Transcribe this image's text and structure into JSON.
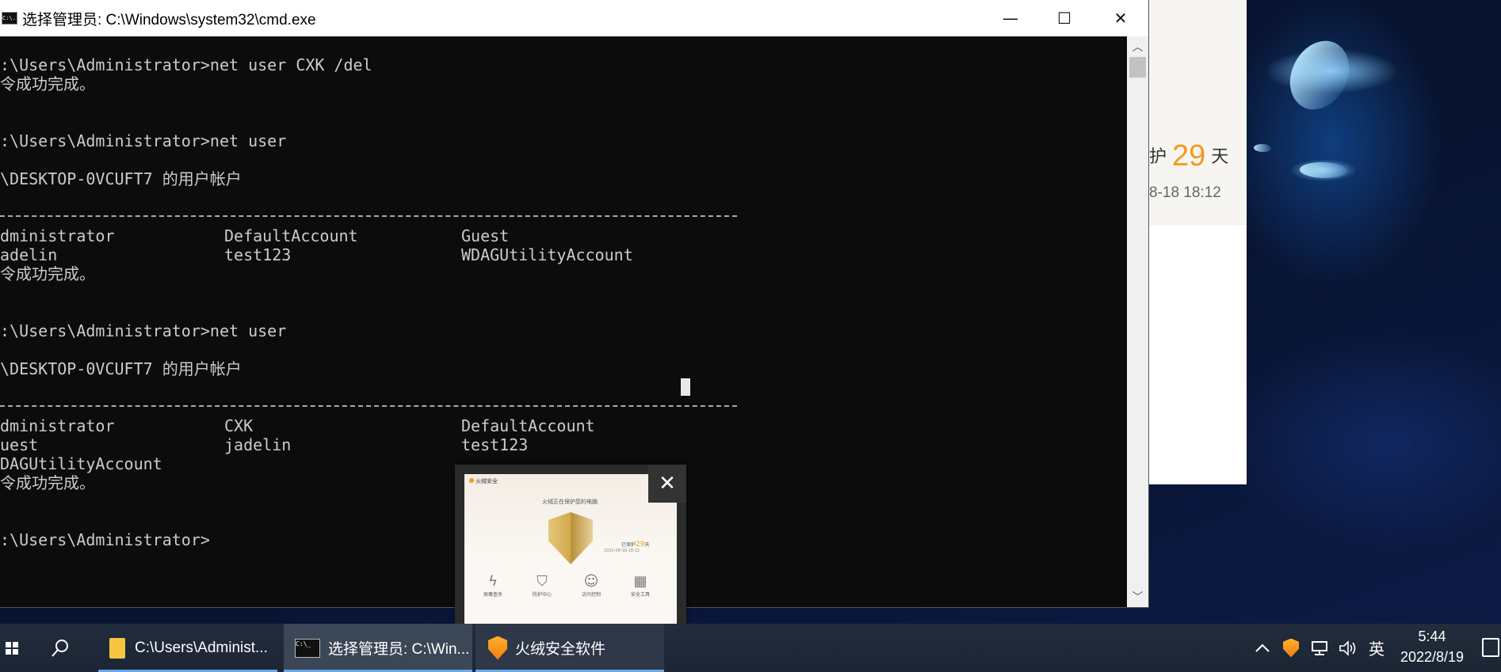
{
  "cmd_window": {
    "title": "选择管理员: C:\\Windows\\system32\\cmd.exe",
    "icon_text": "C:\\.",
    "minimize": "—",
    "maximize": "☐",
    "close": "✕"
  },
  "console": {
    "lines": [
      ":\\Users\\Administrator>net user CXK /del",
      "令成功完成。",
      ":\\Users\\Administrator>net user",
      "\\DESKTOP-0VCUFT7 的用户帐户",
      "令成功完成。",
      ":\\Users\\Administrator>net user",
      "\\DESKTOP-0VCUFT7 的用户帐户",
      "令成功完成。",
      ":\\Users\\Administrator>"
    ],
    "table1": [
      [
        "dministrator",
        "DefaultAccount",
        "Guest"
      ],
      [
        "adelin",
        "test123",
        "WDAGUtilityAccount"
      ]
    ],
    "table2": [
      [
        "dministrator",
        "CXK",
        "DefaultAccount"
      ],
      [
        "uest",
        "jadelin",
        "test123"
      ],
      [
        "DAGUtilityAccount",
        "",
        ""
      ]
    ]
  },
  "background_window": {
    "protect_prefix": "护",
    "days": "29",
    "days_unit": "天",
    "date": "8-18 18:12"
  },
  "preview": {
    "close": "✕",
    "brand": "火绒安全",
    "message": "火绒正在保护您的电脑",
    "protect_days_label": "已保护",
    "protect_days": "29",
    "protect_days_unit": "天",
    "protect_date": "2022-08-18 18:12",
    "tools": [
      "病毒查杀",
      "防护中心",
      "访问控制",
      "安全工具"
    ]
  },
  "taskbar": {
    "apps": [
      {
        "label": "C:\\Users\\Administ..."
      },
      {
        "label": "选择管理员: C:\\Win..."
      },
      {
        "label": "火绒安全软件"
      }
    ],
    "tray": {
      "chevron": "^",
      "ime": "英",
      "time": "5:44",
      "date": "2022/8/19"
    },
    "colors": {
      "accent": "#6aa8e8",
      "huorong_orange": "#f39a1e"
    }
  }
}
